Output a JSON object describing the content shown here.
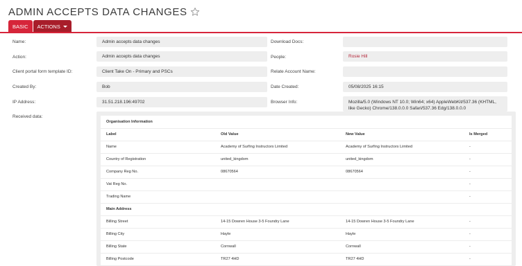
{
  "page": {
    "title": "ADMIN ACCEPTS DATA CHANGES"
  },
  "tabs": {
    "basic": "BASIC",
    "actions": "ACTIONS"
  },
  "fields": {
    "name": {
      "label": "Name:",
      "value": "Admin accepts data changes"
    },
    "action": {
      "label": "Action:",
      "value": "Admin accepts data changes"
    },
    "template": {
      "label": "Client portal form template ID:",
      "value": "Client Take On - Primary and PSCs"
    },
    "created_by": {
      "label": "Created By:",
      "value": "Bob"
    },
    "ip": {
      "label": "IP Address:",
      "value": "31.51.218.196:49702"
    },
    "received": {
      "label": "Received data:"
    },
    "download_docs": {
      "label": "Download Docs:",
      "value": ""
    },
    "people": {
      "label": "People:",
      "value": "Rosie Hill"
    },
    "relate_account": {
      "label": "Relate Account Name:",
      "value": ""
    },
    "date_created": {
      "label": "Date Created:",
      "value": "05/08/2025 16:15"
    },
    "browser": {
      "label": "Browser Info:",
      "value": "Mozilla/5.0 (Windows NT 10.0; Win64; x64) AppleWebKit/537.36 (KHTML, like Gecko) Chrome/138.0.0.0 Safari/537.36 Edg/138.0.0.0"
    }
  },
  "received_table": {
    "section1": "Organisation Information",
    "headers": {
      "label": "Label",
      "old": "Old Value",
      "new": "New Value",
      "merged": "Is Merged"
    },
    "rows1": [
      {
        "label": "Name",
        "old": "Academy of Surfing Instructors Limited",
        "new": "Academy of Surfing Instructors Limited",
        "merged": "-"
      },
      {
        "label": "Country of Registration",
        "old": "united_kingdom",
        "new": "united_kingdom",
        "merged": "-"
      },
      {
        "label": "Company Reg No.",
        "old": "08670564",
        "new": "08670564",
        "merged": "-"
      },
      {
        "label": "Vat Reg No.",
        "old": "",
        "new": "",
        "merged": "-"
      },
      {
        "label": "Trading Name",
        "old": "",
        "new": "",
        "merged": "-"
      }
    ],
    "section2": "Main Address",
    "rows2": [
      {
        "label": "Billing Street",
        "old": "14-15 Dowren House 3-5 Foundry Lane",
        "new": "14-15 Dowren House 3-5 Foundry Lane",
        "merged": "-"
      },
      {
        "label": "Billing City",
        "old": "Hayle",
        "new": "Hayle",
        "merged": "-"
      },
      {
        "label": "Billing State",
        "old": "Cornwall",
        "new": "Cornwall",
        "merged": "-"
      },
      {
        "label": "Billing Postcode",
        "old": "TR27 4HD",
        "new": "TR27 4HD",
        "merged": "-"
      }
    ]
  },
  "icons": {
    "favorite": "star-outline-icon",
    "dropdown": "caret-down-icon"
  },
  "colors": {
    "accent": "#d6253a",
    "accent_dark": "#a81d2a",
    "link": "#b5283b",
    "field_bg": "#eeeeee"
  }
}
